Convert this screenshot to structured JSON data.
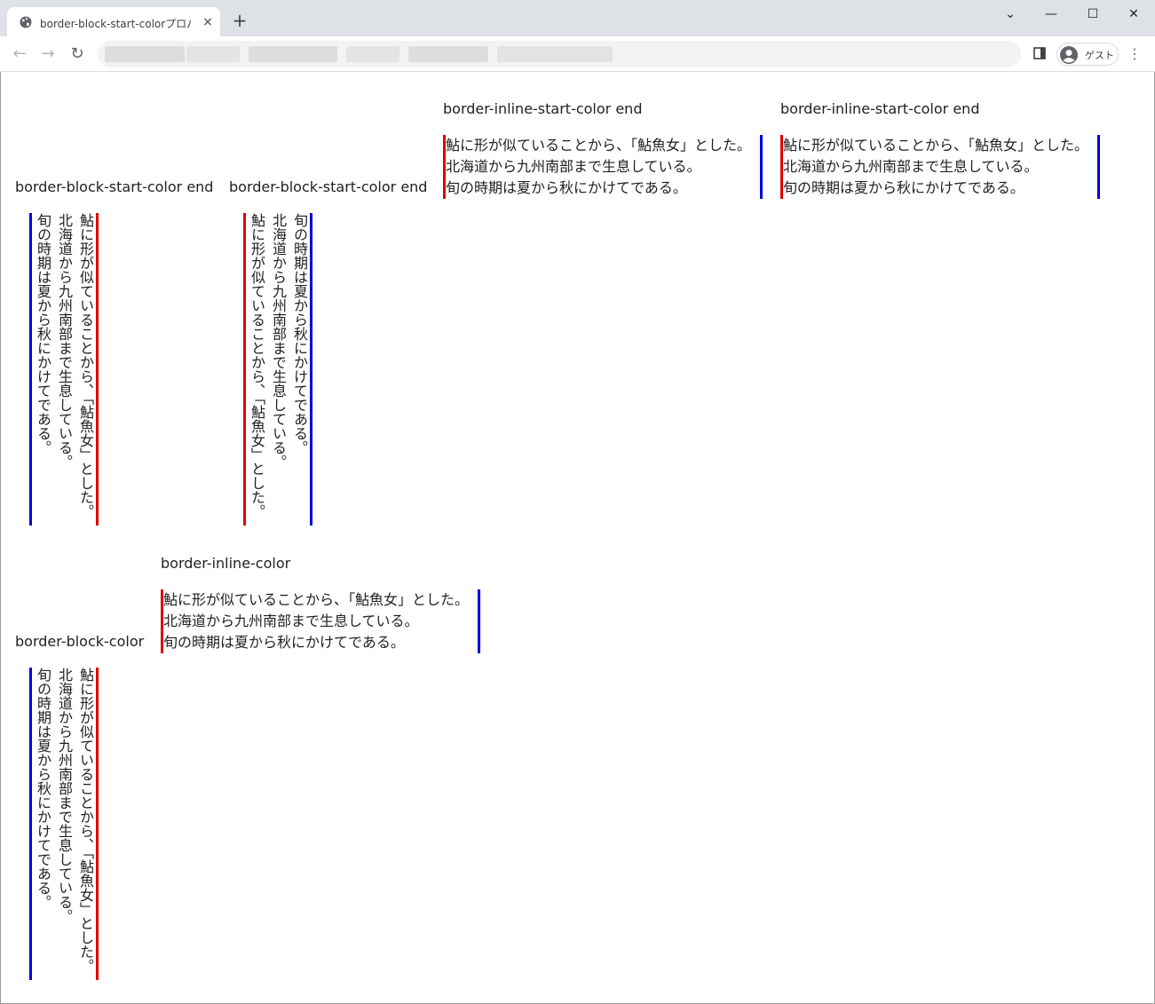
{
  "browser": {
    "tab_title": "border-block-start-colorプロパティ",
    "tab_close": "×",
    "new_tab": "+",
    "profile_label": "ゲスト",
    "menu_glyph": "⋮",
    "back_glyph": "←",
    "forward_glyph": "→",
    "reload_glyph": "↻",
    "minimize_glyph": "—",
    "maximize_glyph": "☐",
    "close_glyph": "✕",
    "tabsearch_glyph": "⌄"
  },
  "colors": {
    "start": "#e00000",
    "end": "#0000dd"
  },
  "content": {
    "lines": [
      "鮎に形が似ていることから、「鮎魚女」とした。",
      "北海道から九州南部まで生息している。",
      "旬の時期は夏から秋にかけてである。"
    ],
    "examples": [
      {
        "heading": "border-block-start-color end"
      },
      {
        "heading": "border-block-start-color end"
      },
      {
        "heading": "border-inline-start-color end"
      },
      {
        "heading": "border-inline-start-color end"
      },
      {
        "heading": "border-block-color"
      },
      {
        "heading": "border-inline-color"
      }
    ]
  }
}
